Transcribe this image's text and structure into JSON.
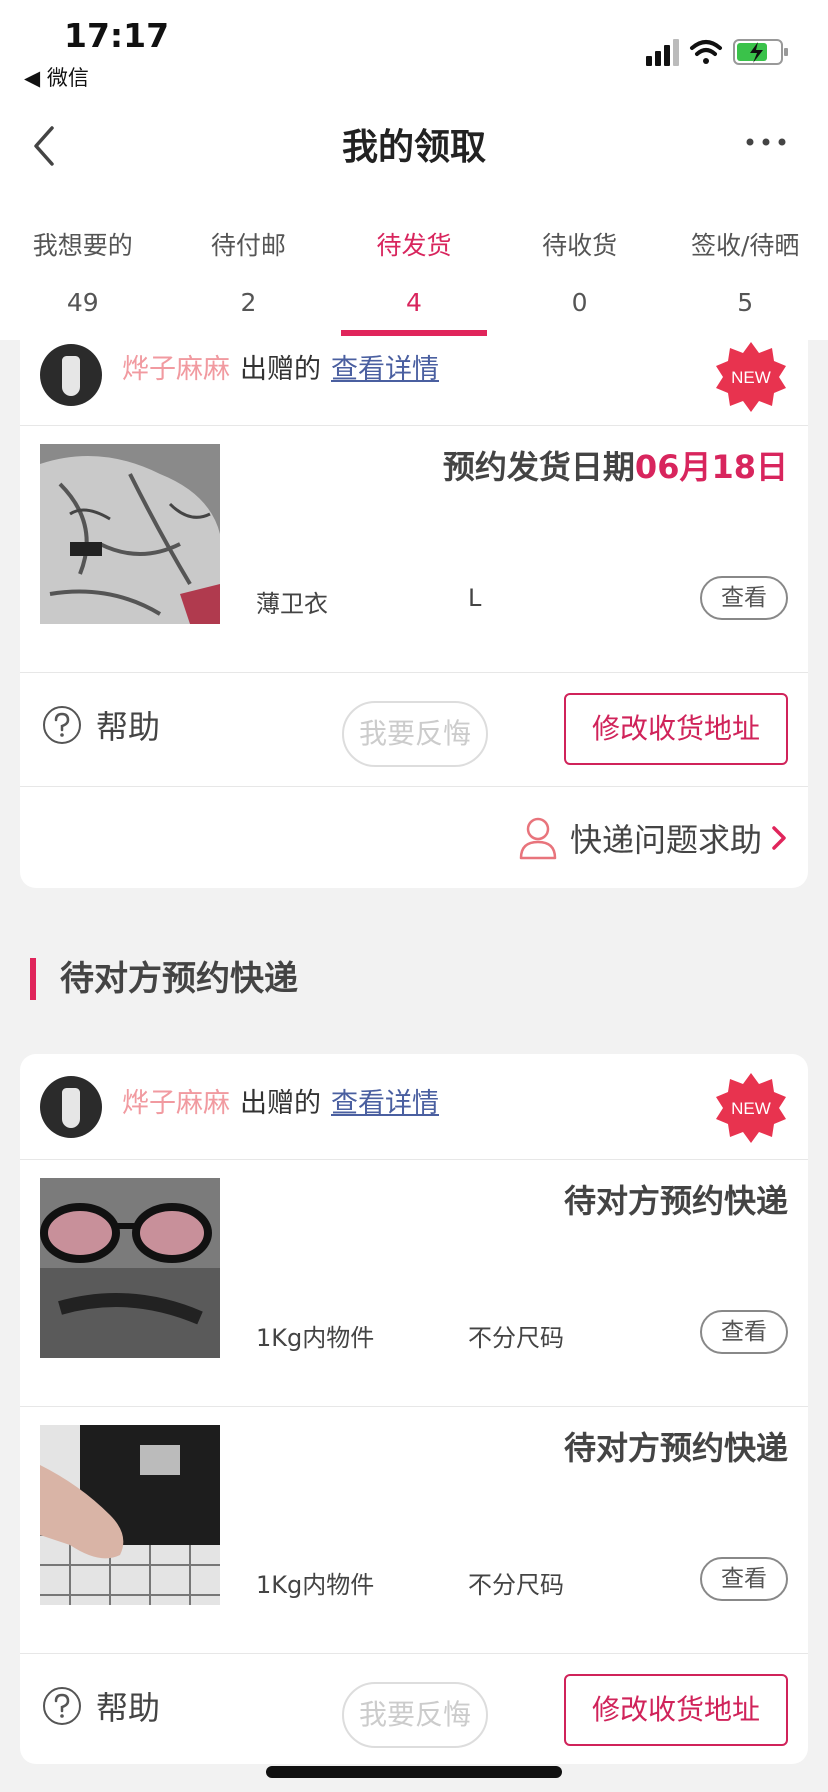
{
  "status_bar": {
    "time": "17:17",
    "back_app": "◀ 微信"
  },
  "nav": {
    "title": "我的领取"
  },
  "tabs": [
    {
      "label": "我想要的",
      "count": "49"
    },
    {
      "label": "待付邮",
      "count": "2"
    },
    {
      "label": "待发货",
      "count": "4",
      "active": true
    },
    {
      "label": "待收货",
      "count": "0"
    },
    {
      "label": "签收/待晒",
      "count": "5"
    }
  ],
  "card1": {
    "giver": "烨子麻麻",
    "gift_word": "出赠的",
    "detail_link": "查看详情",
    "new_badge": "NEW",
    "item": {
      "status_prefix": "预约发货日期",
      "status_date": "06月18日",
      "name": "薄卫衣",
      "size": "L",
      "view_label": "查看"
    },
    "help_label": "帮助",
    "regret_label": "我要反悔",
    "modify_label": "修改收货地址",
    "express_label": "快递问题求助"
  },
  "section": {
    "title": "待对方预约快递"
  },
  "card2": {
    "giver": "烨子麻麻",
    "gift_word": "出赠的",
    "detail_link": "查看详情",
    "new_badge": "NEW",
    "items": [
      {
        "status": "待对方预约快递",
        "name": "1Kg内物件",
        "size": "不分尺码",
        "view_label": "查看"
      },
      {
        "status": "待对方预约快递",
        "name": "1Kg内物件",
        "size": "不分尺码",
        "view_label": "查看"
      }
    ],
    "help_label": "帮助",
    "regret_label": "我要反悔",
    "modify_label": "修改收货地址"
  },
  "colors": {
    "accent": "#e0255b",
    "giver": "#f19aa0",
    "link": "#4a5fa0"
  }
}
